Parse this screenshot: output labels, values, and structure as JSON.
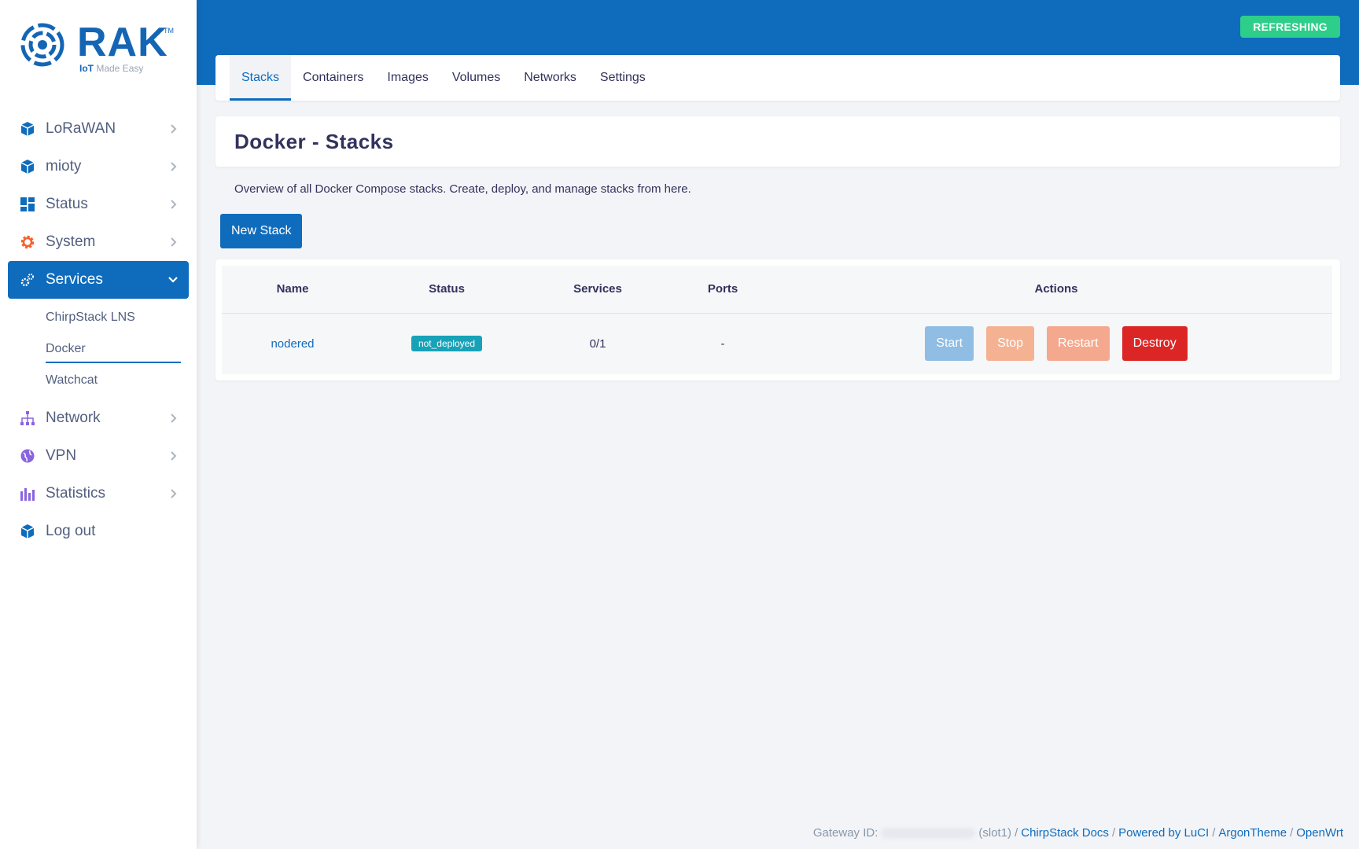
{
  "brand": {
    "name": "RAK",
    "tm": "TM",
    "tagline_prefix": "IoT",
    "tagline_rest": " Made Easy"
  },
  "refresh_badge": "REFRESHING",
  "sidebar": {
    "items": [
      {
        "label": "LoRaWAN",
        "icon": "cube-icon"
      },
      {
        "label": "mioty",
        "icon": "cube-icon"
      },
      {
        "label": "Status",
        "icon": "dashboard-icon"
      },
      {
        "label": "System",
        "icon": "gear-icon"
      },
      {
        "label": "Services",
        "icon": "cogs-icon",
        "expanded": true
      },
      {
        "label": "Network",
        "icon": "sitemap-icon"
      },
      {
        "label": "VPN",
        "icon": "globe-icon"
      },
      {
        "label": "Statistics",
        "icon": "bar-chart-icon"
      },
      {
        "label": "Log out",
        "icon": "cube-icon"
      }
    ],
    "services_sub": [
      "ChirpStack LNS",
      "Docker",
      "Watchcat"
    ],
    "current_sub": "Docker"
  },
  "tabs": [
    "Stacks",
    "Containers",
    "Images",
    "Volumes",
    "Networks",
    "Settings"
  ],
  "active_tab": "Stacks",
  "page": {
    "title": "Docker - Stacks",
    "description": "Overview of all Docker Compose stacks. Create, deploy, and manage stacks from here.",
    "new_button": "New Stack"
  },
  "table": {
    "headers": [
      "Name",
      "Status",
      "Services",
      "Ports",
      "Actions"
    ],
    "rows": [
      {
        "name": "nodered",
        "status": "not_deployed",
        "services": "0/1",
        "ports": "-",
        "actions": [
          "Start",
          "Stop",
          "Restart",
          "Destroy"
        ]
      }
    ]
  },
  "footer": {
    "gateway_label": "Gateway ID:",
    "slot": "(slot1)",
    "sep": "/",
    "links": [
      "ChirpStack Docs",
      "Powered by LuCI",
      "ArgonTheme",
      "OpenWrt"
    ]
  },
  "colors": {
    "primary": "#0f6cbd",
    "success": "#2dce89",
    "danger": "#dc2626",
    "info": "#17a2b8"
  }
}
